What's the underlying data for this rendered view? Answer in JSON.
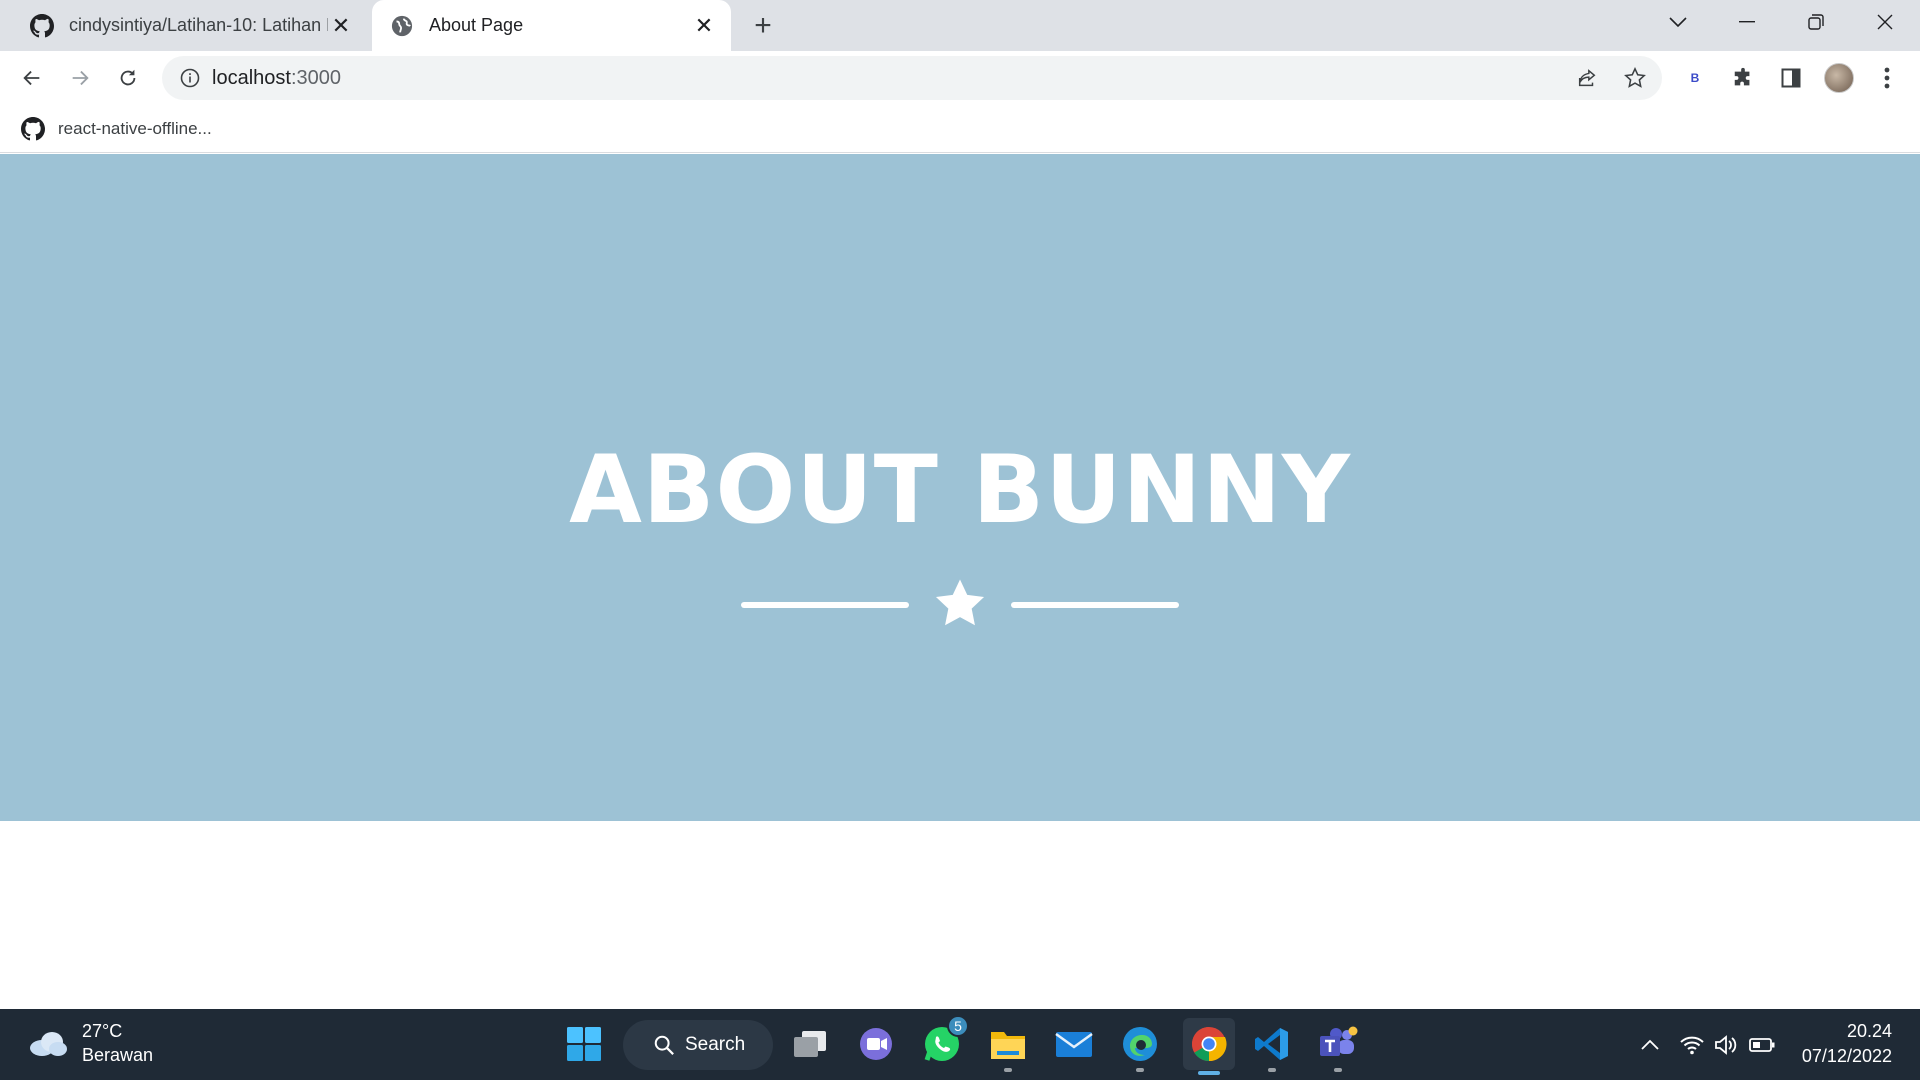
{
  "browser": {
    "tabs": [
      {
        "title": "cindysintiya/Latihan-10: Latihan M",
        "favicon": "github-icon",
        "active": false
      },
      {
        "title": "About Page",
        "favicon": "globe-icon",
        "active": true
      }
    ],
    "address": {
      "host": "localhost",
      "port": ":3000"
    },
    "bookmarks": [
      {
        "label": "react-native-offline...",
        "favicon": "github-icon"
      }
    ],
    "extension_label": "B"
  },
  "page": {
    "hero_title": "ABOUT BUNNY",
    "background_color": "#9dc2d5",
    "divider_icon": "star-icon"
  },
  "taskbar": {
    "weather": {
      "temperature": "27°C",
      "condition": "Berawan"
    },
    "search_label": "Search",
    "whatsapp_badge": "5",
    "clock": {
      "time": "20.24",
      "date": "07/12/2022"
    }
  }
}
